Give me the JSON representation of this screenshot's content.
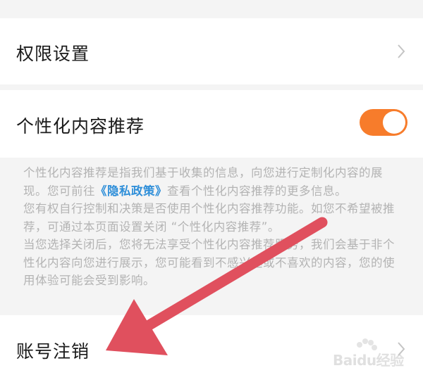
{
  "settings": {
    "permission": {
      "label": "权限设置"
    },
    "personalization": {
      "label": "个性化内容推荐",
      "toggle_on": true,
      "toggle_color": "#f77c2b"
    },
    "description": {
      "part1": "个性化内容推荐是指我们基于收集的信息，向您进行定制化内容的展现。您可前往",
      "privacy_link": "《隐私政策》",
      "part2": "查看个性化内容推荐的更多信息。",
      "para2": "您有权自行控制和决策是否使用个性化内容推荐功能。如您不希望被推荐，可通过本页面设置关闭 “个性化内容推荐”。",
      "para3": "当您选择关闭后，您将无法享受个性化内容推荐服务，我们会基于非个性化内容向您进行展示，您可能看到不感兴趣或不喜欢的内容，您的使用体验可能会受到影响。"
    },
    "account_cancel": {
      "label": "账号注销"
    }
  },
  "annotation": {
    "arrow_color": "#e0505e"
  },
  "watermark": {
    "text": "Baidu经验"
  }
}
